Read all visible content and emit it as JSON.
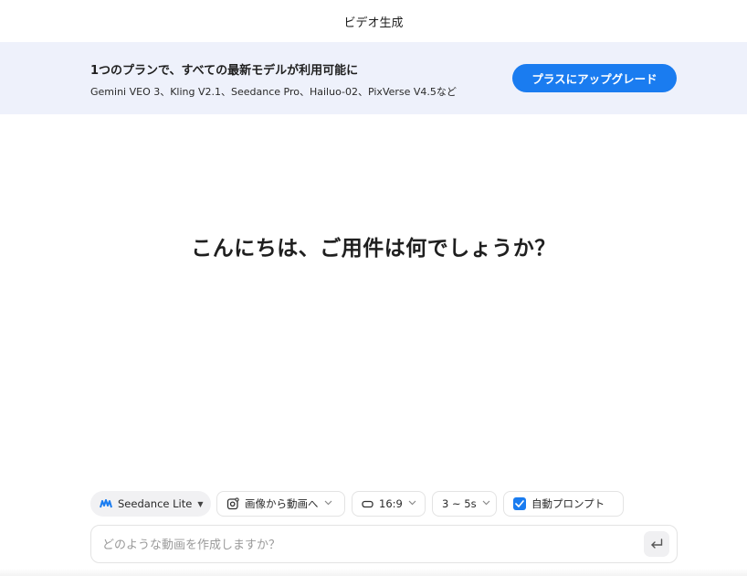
{
  "header": {
    "title": "ビデオ生成"
  },
  "banner": {
    "title": "1つのプランで、すべての最新モデルが利用可能に",
    "subtitle": "Gemini VEO 3、Kling V2.1、Seedance Pro、Hailuo-02、PixVerse V4.5など",
    "upgrade_label": "プラスにアップグレード",
    "accent_color": "#1a7cf0",
    "background_color": "#eef1fb"
  },
  "main": {
    "greeting": "こんにちは、ご用件は何でしょうか？"
  },
  "toolbar": {
    "model": {
      "label": "Seedance Lite",
      "icon": "seedance-logo-icon"
    },
    "mode": {
      "label": "画像から動画へ",
      "icon": "image-to-video-icon"
    },
    "ratio": {
      "label": "16:9",
      "icon": "aspect-ratio-icon"
    },
    "duration": {
      "label": "3 ~ 5s"
    },
    "auto_prompt": {
      "label": "自動プロンプト",
      "checked": true
    }
  },
  "composer": {
    "placeholder": "どのような動画を作成しますか？",
    "value": "",
    "send_icon": "enter-return-icon"
  }
}
